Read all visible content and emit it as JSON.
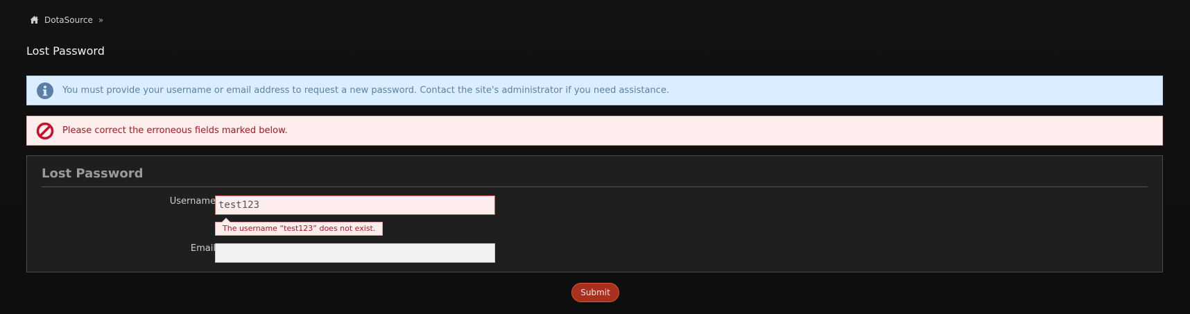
{
  "breadcrumb": {
    "home_icon": "home-icon",
    "site_name": "DotaSource",
    "separator": "»"
  },
  "page_title": "Lost Password",
  "info_notice": {
    "icon": "info-icon",
    "text": "You must provide your username or email address to request a new password. Contact the site's administrator if you need assistance."
  },
  "error_notice": {
    "icon": "no-entry-icon",
    "text": "Please correct the erroneous fields marked below."
  },
  "form": {
    "legend": "Lost Password",
    "username": {
      "label": "Username",
      "value": "test123",
      "error": "The username “test123” does not exist."
    },
    "email": {
      "label": "Email",
      "value": ""
    },
    "submit_label": "Submit"
  },
  "colors": {
    "background": "#0f0f0f",
    "info_bg": "#dbeeff",
    "info_text": "#5c7fa6",
    "error_bg": "#fdeded",
    "error_text": "#b3121d",
    "submit_bg": "#a8301d"
  }
}
